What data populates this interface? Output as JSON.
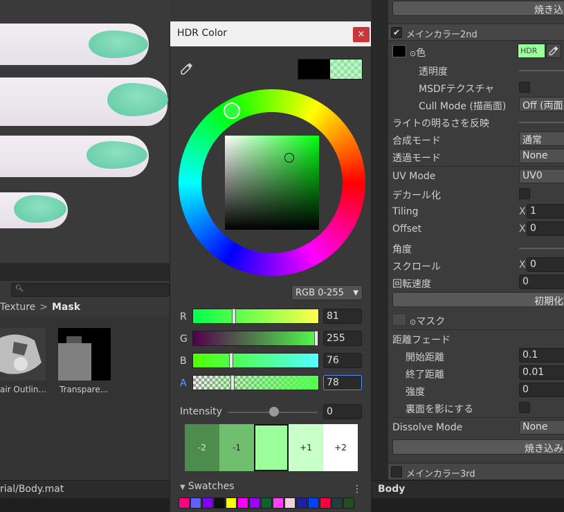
{
  "project": {
    "breadcrumb": [
      "Texture",
      "Mask"
    ],
    "thumbnails": [
      {
        "label": "air Outlin..."
      },
      {
        "label": "Transpare..."
      }
    ],
    "status_path": "rial/Body.mat"
  },
  "dialog": {
    "title": "HDR Color",
    "close_glyph": "×",
    "mode": "RGB 0-255",
    "channels": [
      {
        "label": "R",
        "value": "81",
        "fraction": 0.318
      },
      {
        "label": "G",
        "value": "255",
        "fraction": 1.0
      },
      {
        "label": "B",
        "value": "76",
        "fraction": 0.298
      },
      {
        "label": "A",
        "value": "78",
        "fraction": 0.306
      }
    ],
    "intensity": {
      "label": "Intensity",
      "value": "0"
    },
    "stops": [
      {
        "label": "-2",
        "color": "#4e8c4e"
      },
      {
        "label": "-1",
        "color": "#6fbf6f"
      },
      {
        "label": "",
        "color": "#9bff9b"
      },
      {
        "label": "+1",
        "color": "#c9ffc9"
      },
      {
        "label": "+2",
        "color": "#ffffff"
      }
    ],
    "swatches_label": "Swatches",
    "swatches_menu": "⋮",
    "swatch_colors": [
      "#ff0080",
      "#6060ff",
      "#8000ff",
      "#101010",
      "#ffff00",
      "#ff00ff",
      "#a000ff",
      "#106030",
      "#ff40ff",
      "#f0d0e0",
      "#2020a0",
      "#0040ff",
      "#ff0040",
      "#204040",
      "#205020"
    ]
  },
  "inspector": {
    "top_button": "焼き込",
    "section_main2": "メインカラー2nd",
    "color_label": "色",
    "hdr_tag": "HDR",
    "rows": {
      "transparency": "透明度",
      "msdf": "MSDFテクスチャ",
      "cull_mode": "Cull Mode (描画面)",
      "cull_mode_value": "Off (両面",
      "light": "ライトの明るさを反映",
      "blend": "合成モード",
      "blend_value": "通常",
      "alpha": "透過モード",
      "alpha_value": "None",
      "uv_mode": "UV Mode",
      "uv_mode_value": "UV0",
      "decal": "デカール化",
      "tiling": "Tiling",
      "tiling_x": "X",
      "tiling_value": "1",
      "offset": "Offset",
      "offset_x": "X",
      "offset_value": "0",
      "angle": "角度",
      "scroll": "スクロール",
      "scroll_x": "X",
      "scroll_value": "0",
      "rotation": "回転速度",
      "rotation_value": "0",
      "reset_button": "初期化",
      "mask": "マスク",
      "distance_fade": "距離フェード",
      "start_distance": "開始距離",
      "start_distance_value": "0.1",
      "end_distance": "終了距離",
      "end_distance_value": "0.01",
      "strength": "強度",
      "strength_value": "0",
      "backface": "裏面を影にする",
      "dissolve": "Dissolve Mode",
      "dissolve_value": "None",
      "bake_button": "焼き込み"
    },
    "section_main3": "メインカラー3rd",
    "status_title": "Body"
  }
}
